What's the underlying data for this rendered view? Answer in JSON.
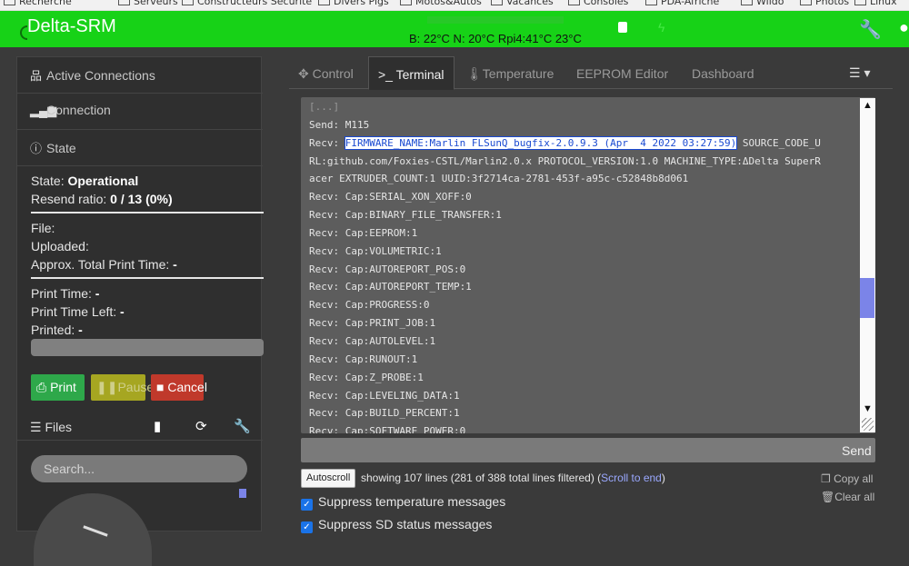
{
  "bookmarks": [
    "Recherche",
    "Serveurs",
    "Constructeurs Sécurité",
    "Divers Pigs",
    "Motos&Autos",
    "Vacances",
    "Consoles",
    "PDA-Afriche",
    "Wiido",
    "Photos",
    "Linux"
  ],
  "navbar": {
    "brand": "Delta-SRM",
    "temps": "B: 22°C  N: 20°C  Rpi4:41°C  23°C",
    "accent": "#17d217"
  },
  "sidebar": {
    "active_connections": "Active Connections",
    "connection": "Connection",
    "state": "State",
    "state_label": "State:",
    "state_value": "Operational",
    "resend_label": "Resend ratio:",
    "resend_value": "0 / 13 (0%)",
    "file_label": "File:",
    "uploaded_label": "Uploaded:",
    "approx_label": "Approx. Total Print Time:",
    "approx_value": "-",
    "print_time_label": "Print Time:",
    "print_time_value": "-",
    "print_time_left_label": "Print Time Left:",
    "print_time_left_value": "-",
    "printed_label": "Printed:",
    "printed_value": "-",
    "print_btn": "Print",
    "pause_btn": "Pause",
    "cancel_btn": "Cancel",
    "files": "Files",
    "search_placeholder": "Search..."
  },
  "tabs": {
    "control": "Control",
    "terminal": "Terminal",
    "temperature": "Temperature",
    "eeprom": "EEPROM Editor",
    "dashboard": "Dashboard"
  },
  "terminal": {
    "l0": "[...]",
    "l1": "Send: M115",
    "l2a": "Recv: ",
    "l2b": "FIRMWARE_NAME:Marlin FLSunQ_bugfix-2.0.9.3 (Apr  4 2022 03:27:59)",
    "l2c": " SOURCE_CODE_U",
    "l3": "RL:github.com/Foxies-CSTL/Marlin2.0.x PROTOCOL_VERSION:1.0 MACHINE_TYPE:ΔDelta SuperR",
    "l4": "acer EXTRUDER_COUNT:1 UUID:3f2714ca-2781-453f-a95c-c52848b8d061",
    "l5": "Recv: Cap:SERIAL_XON_XOFF:0",
    "l6": "Recv: Cap:BINARY_FILE_TRANSFER:1",
    "l7": "Recv: Cap:EEPROM:1",
    "l8": "Recv: Cap:VOLUMETRIC:1",
    "l9": "Recv: Cap:AUTOREPORT_POS:0",
    "l10": "Recv: Cap:AUTOREPORT_TEMP:1",
    "l11": "Recv: Cap:PROGRESS:0",
    "l12": "Recv: Cap:PRINT_JOB:1",
    "l13": "Recv: Cap:AUTOLEVEL:1",
    "l14": "Recv: Cap:RUNOUT:1",
    "l15": "Recv: Cap:Z_PROBE:1",
    "l16": "Recv: Cap:LEVELING_DATA:1",
    "l17": "Recv: Cap:BUILD_PERCENT:1",
    "l18": "Recv: Cap:SOFTWARE_POWER:0"
  },
  "footer": {
    "send": "Send",
    "autoscroll": "Autoscroll",
    "status_main": "showing 107 lines (281 of 388 total lines filtered) (",
    "status_link": "Scroll to end",
    "status_end": ")",
    "copy_all": "Copy all",
    "clear_all": "Clear all",
    "suppress_temp": "Suppress temperature messages",
    "suppress_sd": "Suppress SD status messages"
  }
}
